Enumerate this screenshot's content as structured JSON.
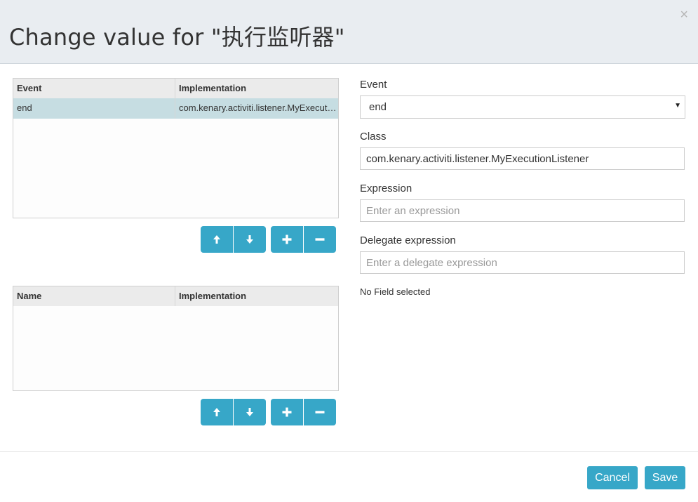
{
  "dialog": {
    "title": "Change value for \"执行监听器\"",
    "close_glyph": "×"
  },
  "listeners_grid": {
    "columns": [
      "Event",
      "Implementation"
    ],
    "rows": [
      {
        "event": "end",
        "implementation": "com.kenary.activiti.listener.MyExecutionListener",
        "selected": true
      }
    ]
  },
  "fields_grid": {
    "columns": [
      "Name",
      "Implementation"
    ],
    "rows": []
  },
  "toolbar_icons": [
    "arrow-up-icon",
    "arrow-down-icon",
    "plus-icon",
    "minus-icon"
  ],
  "form": {
    "event_label": "Event",
    "event_value": "end",
    "class_label": "Class",
    "class_value": "com.kenary.activiti.listener.MyExecutionListener",
    "expression_label": "Expression",
    "expression_placeholder": "Enter an expression",
    "delegate_label": "Delegate expression",
    "delegate_placeholder": "Enter a delegate expression",
    "no_field_text": "No Field selected"
  },
  "footer": {
    "cancel_label": "Cancel",
    "save_label": "Save"
  },
  "colors": {
    "accent": "#37a7c8",
    "header_bg": "#e9edf1",
    "selected_row": "#c6dde2"
  }
}
